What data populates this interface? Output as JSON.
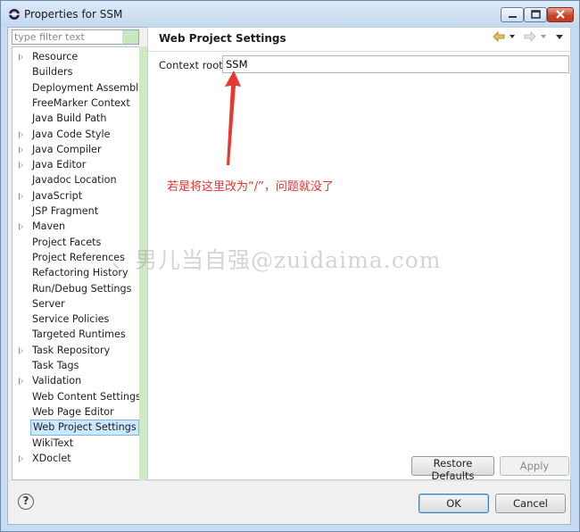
{
  "window": {
    "title": "Properties for SSM"
  },
  "filter": {
    "placeholder": "type filter text"
  },
  "tree": {
    "items": [
      {
        "label": "Resource",
        "expandable": true
      },
      {
        "label": "Builders",
        "expandable": false
      },
      {
        "label": "Deployment Assembly",
        "expandable": false
      },
      {
        "label": "FreeMarker Context",
        "expandable": false
      },
      {
        "label": "Java Build Path",
        "expandable": false
      },
      {
        "label": "Java Code Style",
        "expandable": true
      },
      {
        "label": "Java Compiler",
        "expandable": true
      },
      {
        "label": "Java Editor",
        "expandable": true
      },
      {
        "label": "Javadoc Location",
        "expandable": false
      },
      {
        "label": "JavaScript",
        "expandable": true
      },
      {
        "label": "JSP Fragment",
        "expandable": false
      },
      {
        "label": "Maven",
        "expandable": true
      },
      {
        "label": "Project Facets",
        "expandable": false
      },
      {
        "label": "Project References",
        "expandable": false
      },
      {
        "label": "Refactoring History",
        "expandable": false
      },
      {
        "label": "Run/Debug Settings",
        "expandable": false
      },
      {
        "label": "Server",
        "expandable": false
      },
      {
        "label": "Service Policies",
        "expandable": false
      },
      {
        "label": "Targeted Runtimes",
        "expandable": false
      },
      {
        "label": "Task Repository",
        "expandable": true
      },
      {
        "label": "Task Tags",
        "expandable": false
      },
      {
        "label": "Validation",
        "expandable": true
      },
      {
        "label": "Web Content Settings",
        "expandable": false
      },
      {
        "label": "Web Page Editor",
        "expandable": false
      },
      {
        "label": "Web Project Settings",
        "expandable": false,
        "selected": true
      },
      {
        "label": "WikiText",
        "expandable": false
      },
      {
        "label": "XDoclet",
        "expandable": true
      }
    ]
  },
  "page": {
    "header": "Web Project Settings",
    "context_root_label": "Context root:",
    "context_root_value": "SSM"
  },
  "annotation": {
    "text": "若是将这里改为“/”，问题就没了",
    "color": "#e5332f"
  },
  "watermark": {
    "text": "、男儿当自强@zuidaima.com"
  },
  "buttons": {
    "restore_defaults": "Restore Defaults",
    "apply": "Apply",
    "ok": "OK",
    "cancel": "Cancel",
    "help": "?"
  }
}
